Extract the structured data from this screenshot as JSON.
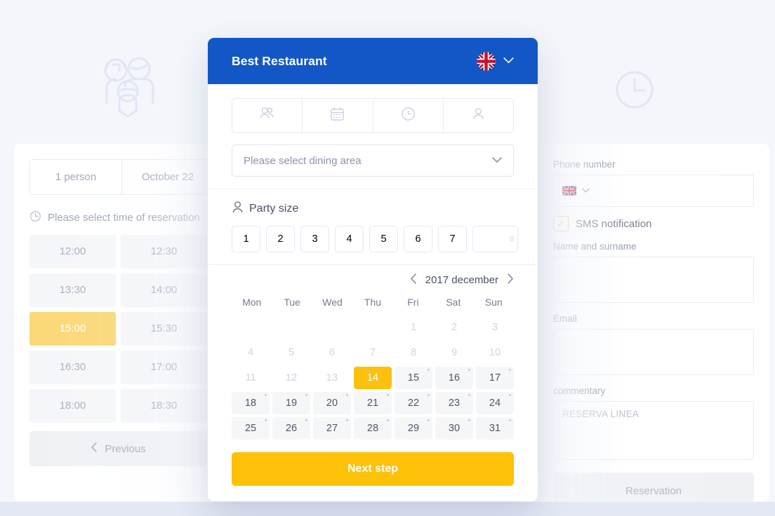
{
  "background": {
    "page_color": "#f4f6fb",
    "bottom_band_color": "#e3e8f4",
    "decorations": [
      {
        "icon": "family-group-icon",
        "color": "#dee5f5"
      },
      {
        "icon": "clock-icon",
        "color": "#dee5f5"
      }
    ]
  },
  "left_panel": {
    "summary_tabs": [
      "1 person",
      "October 22"
    ],
    "time_hint": "Please select time of reservation",
    "time_hint_icon": "clock-icon",
    "time_slots": [
      "12:00",
      "12:30",
      "13:30",
      "14:00",
      "15:00",
      "15:30",
      "16:30",
      "17:00",
      "18:00",
      "18:30"
    ],
    "selected_time": "15:00",
    "selected_time_color": "#fbd775",
    "previous_label": "Previous",
    "previous_icon": "chevron-left-icon"
  },
  "right_panel": {
    "phone_label": "Phone number",
    "phone_value": "",
    "phone_flag_icon": "uk-flag-icon",
    "phone_chevron_icon": "chevron-down-icon",
    "sms_label": "SMS notification",
    "sms_checked": true,
    "sms_check_color": "#f6bf3b",
    "name_label": "Name and surname",
    "name_value": "",
    "email_label": "Email",
    "email_value": "",
    "commentary_label": "commentary",
    "commentary_placeholder": "RESERVA LINEA",
    "reservation_button": "Reservation"
  },
  "modal": {
    "header": {
      "title": "Best Restaurant",
      "bg_color": "#1357c7",
      "flag_icon": "uk-flag-icon",
      "chevron_icon": "chevron-down-icon"
    },
    "steps": [
      {
        "name": "party-size-step",
        "icon": "people-icon"
      },
      {
        "name": "date-step",
        "icon": "calendar-icon"
      },
      {
        "name": "time-step",
        "icon": "clock-icon"
      },
      {
        "name": "contact-step",
        "icon": "person-icon"
      }
    ],
    "dining_area": {
      "placeholder": "Please select dining area",
      "chevron_icon": "chevron-down-icon"
    },
    "party_size": {
      "label": "Party size",
      "icon": "person-icon",
      "options": [
        "1",
        "2",
        "3",
        "4",
        "5",
        "6",
        "7"
      ],
      "overflow_option": "8"
    },
    "calendar": {
      "month_label": "2017 december",
      "prev_icon": "chevron-left-icon",
      "next_icon": "chevron-right-icon",
      "weekdays": [
        "Mon",
        "Tue",
        "Wed",
        "Thu",
        "Fri",
        "Sat",
        "Sun"
      ],
      "selected_day": 14,
      "selected_color": "#fcc10f",
      "lead_blanks": 4,
      "days": [
        {
          "n": 1,
          "state": "off"
        },
        {
          "n": 2,
          "state": "off"
        },
        {
          "n": 3,
          "state": "off"
        },
        {
          "n": 4,
          "state": "off"
        },
        {
          "n": 5,
          "state": "off"
        },
        {
          "n": 6,
          "state": "off"
        },
        {
          "n": 7,
          "state": "off"
        },
        {
          "n": 8,
          "state": "off"
        },
        {
          "n": 9,
          "state": "off"
        },
        {
          "n": 10,
          "state": "off"
        },
        {
          "n": 11,
          "state": "off"
        },
        {
          "n": 12,
          "state": "off"
        },
        {
          "n": 13,
          "state": "off"
        },
        {
          "n": 14,
          "state": "selected"
        },
        {
          "n": 15,
          "state": "on"
        },
        {
          "n": 16,
          "state": "on"
        },
        {
          "n": 17,
          "state": "on"
        },
        {
          "n": 18,
          "state": "on"
        },
        {
          "n": 19,
          "state": "on"
        },
        {
          "n": 20,
          "state": "on"
        },
        {
          "n": 21,
          "state": "on"
        },
        {
          "n": 22,
          "state": "on"
        },
        {
          "n": 23,
          "state": "on"
        },
        {
          "n": 24,
          "state": "on"
        },
        {
          "n": 25,
          "state": "on"
        },
        {
          "n": 26,
          "state": "on"
        },
        {
          "n": 27,
          "state": "on"
        },
        {
          "n": 28,
          "state": "on"
        },
        {
          "n": 29,
          "state": "on"
        },
        {
          "n": 30,
          "state": "on"
        },
        {
          "n": 31,
          "state": "on"
        }
      ]
    },
    "next_step_label": "Next step",
    "next_step_color": "#fdc107"
  }
}
